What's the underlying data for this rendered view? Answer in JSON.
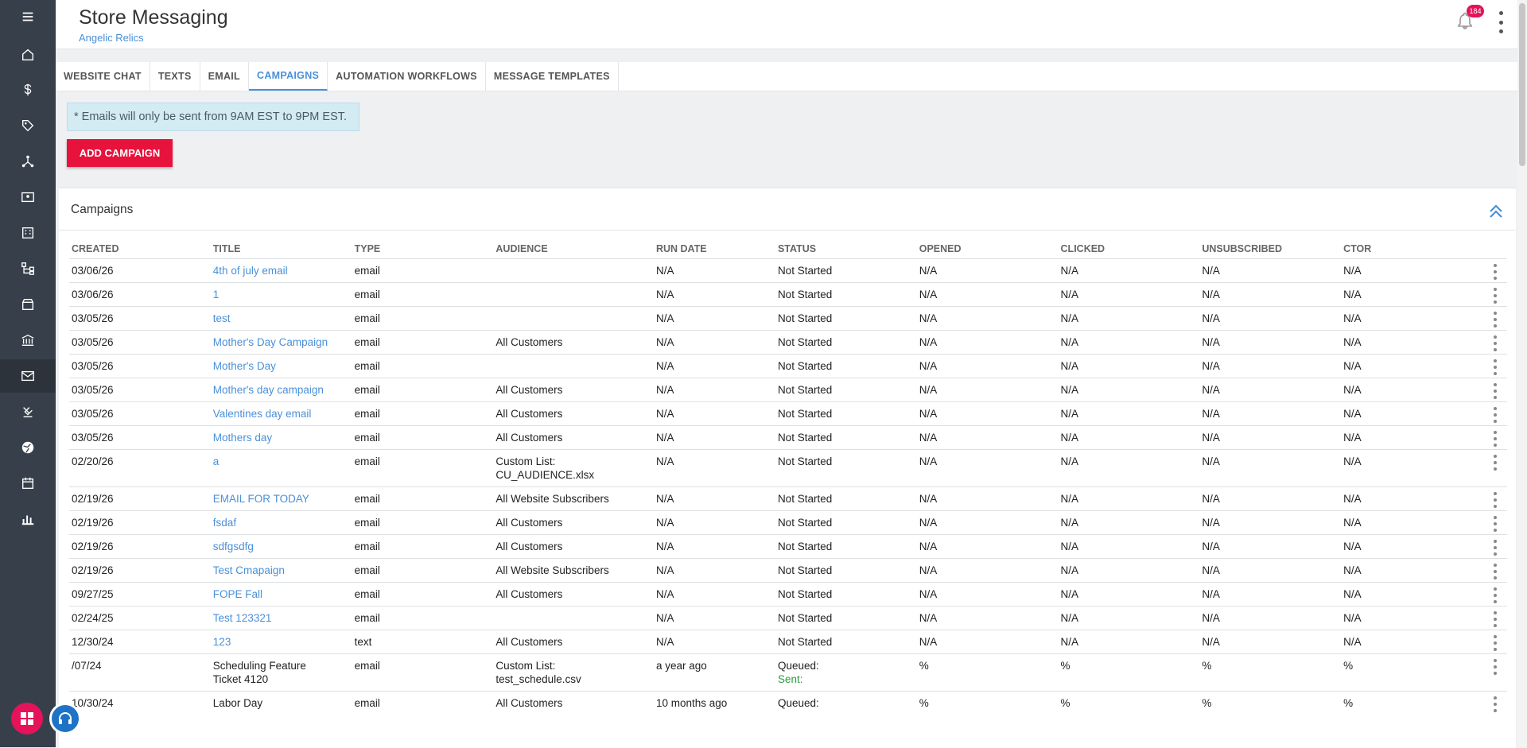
{
  "header": {
    "title": "Store Messaging",
    "subtitle": "Angelic Relics",
    "notification_count": "184"
  },
  "sidebar": {
    "items": [
      "menu-icon",
      "home-icon",
      "dollar-icon",
      "tag-icon",
      "network-icon",
      "id-card-icon",
      "building-icon",
      "sitemap-icon",
      "store-icon",
      "bank-icon",
      "mail-icon",
      "pin-icon",
      "globe-icon",
      "calendar-icon",
      "bar-chart-icon"
    ],
    "active": "mail-icon"
  },
  "tabs": [
    {
      "label": "WEBSITE CHAT"
    },
    {
      "label": "TEXTS"
    },
    {
      "label": "EMAIL"
    },
    {
      "label": "CAMPAIGNS",
      "active": true
    },
    {
      "label": "AUTOMATION WORKFLOWS"
    },
    {
      "label": "MESSAGE TEMPLATES"
    }
  ],
  "notice": "* Emails will only be sent from 9AM EST to 9PM EST.",
  "add_button": "ADD CAMPAIGN",
  "panel": {
    "title": "Campaigns",
    "columns": [
      "CREATED",
      "TITLE",
      "TYPE",
      "AUDIENCE",
      "RUN DATE",
      "STATUS",
      "OPENED",
      "CLICKED",
      "UNSUBSCRIBED",
      "CTOR"
    ],
    "rows": [
      {
        "created": "03/06/26",
        "title": "4th of july email",
        "type": "email",
        "audience": "",
        "run_date": "N/A",
        "status": "Not Started",
        "opened": "N/A",
        "clicked": "N/A",
        "unsubscribed": "N/A",
        "ctor": "N/A"
      },
      {
        "created": "03/06/26",
        "title": "1",
        "type": "email",
        "audience": "",
        "run_date": "N/A",
        "status": "Not Started",
        "opened": "N/A",
        "clicked": "N/A",
        "unsubscribed": "N/A",
        "ctor": "N/A"
      },
      {
        "created": "03/05/26",
        "title": "test",
        "type": "email",
        "audience": "",
        "run_date": "N/A",
        "status": "Not Started",
        "opened": "N/A",
        "clicked": "N/A",
        "unsubscribed": "N/A",
        "ctor": "N/A"
      },
      {
        "created": "03/05/26",
        "title": "Mother's Day Campaign",
        "type": "email",
        "audience": "All Customers",
        "run_date": "N/A",
        "status": "Not Started",
        "opened": "N/A",
        "clicked": "N/A",
        "unsubscribed": "N/A",
        "ctor": "N/A"
      },
      {
        "created": "03/05/26",
        "title": "Mother's Day",
        "type": "email",
        "audience": "",
        "run_date": "N/A",
        "status": "Not Started",
        "opened": "N/A",
        "clicked": "N/A",
        "unsubscribed": "N/A",
        "ctor": "N/A"
      },
      {
        "created": "03/05/26",
        "title": "Mother's day campaign",
        "type": "email",
        "audience": "All Customers",
        "run_date": "N/A",
        "status": "Not Started",
        "opened": "N/A",
        "clicked": "N/A",
        "unsubscribed": "N/A",
        "ctor": "N/A"
      },
      {
        "created": "03/05/26",
        "title": "Valentines day email",
        "type": "email",
        "audience": "All Customers",
        "run_date": "N/A",
        "status": "Not Started",
        "opened": "N/A",
        "clicked": "N/A",
        "unsubscribed": "N/A",
        "ctor": "N/A"
      },
      {
        "created": "03/05/26",
        "title": "Mothers day",
        "type": "email",
        "audience": "All Customers",
        "run_date": "N/A",
        "status": "Not Started",
        "opened": "N/A",
        "clicked": "N/A",
        "unsubscribed": "N/A",
        "ctor": "N/A"
      },
      {
        "created": "02/20/26",
        "title": "a",
        "type": "email",
        "audience": "Custom List:\nCU_AUDIENCE.xlsx",
        "run_date": "N/A",
        "status": "Not Started",
        "opened": "N/A",
        "clicked": "N/A",
        "unsubscribed": "N/A",
        "ctor": "N/A"
      },
      {
        "created": "02/19/26",
        "title": "EMAIL FOR TODAY",
        "type": "email",
        "audience": "All Website Subscribers",
        "run_date": "N/A",
        "status": "Not Started",
        "opened": "N/A",
        "clicked": "N/A",
        "unsubscribed": "N/A",
        "ctor": "N/A"
      },
      {
        "created": "02/19/26",
        "title": "fsdaf",
        "type": "email",
        "audience": "All Customers",
        "run_date": "N/A",
        "status": "Not Started",
        "opened": "N/A",
        "clicked": "N/A",
        "unsubscribed": "N/A",
        "ctor": "N/A"
      },
      {
        "created": "02/19/26",
        "title": "sdfgsdfg",
        "type": "email",
        "audience": "All Customers",
        "run_date": "N/A",
        "status": "Not Started",
        "opened": "N/A",
        "clicked": "N/A",
        "unsubscribed": "N/A",
        "ctor": "N/A"
      },
      {
        "created": "02/19/26",
        "title": "Test Cmapaign",
        "type": "email",
        "audience": "All Website Subscribers",
        "run_date": "N/A",
        "status": "Not Started",
        "opened": "N/A",
        "clicked": "N/A",
        "unsubscribed": "N/A",
        "ctor": "N/A"
      },
      {
        "created": "09/27/25",
        "title": "FOPE Fall",
        "type": "email",
        "audience": "All Customers",
        "run_date": "N/A",
        "status": "Not Started",
        "opened": "N/A",
        "clicked": "N/A",
        "unsubscribed": "N/A",
        "ctor": "N/A"
      },
      {
        "created": "02/24/25",
        "title": "Test 123321",
        "type": "email",
        "audience": "",
        "run_date": "N/A",
        "status": "Not Started",
        "opened": "N/A",
        "clicked": "N/A",
        "unsubscribed": "N/A",
        "ctor": "N/A"
      },
      {
        "created": "12/30/24",
        "title": "123",
        "type": "text",
        "audience": "All Customers",
        "run_date": "N/A",
        "status": "Not Started",
        "opened": "N/A",
        "clicked": "N/A",
        "unsubscribed": "N/A",
        "ctor": "N/A"
      },
      {
        "created": "/07/24",
        "title": "Scheduling Feature\nTicket 4120",
        "title_plain": true,
        "type": "email",
        "audience": "Custom List:\ntest_schedule.csv",
        "run_date": "a year ago",
        "status": "Queued:",
        "status_sent": "Sent:",
        "opened": "%",
        "clicked": "%",
        "unsubscribed": "%",
        "ctor": "%"
      },
      {
        "created": "10/30/24",
        "title": "Labor Day",
        "title_plain": true,
        "type": "email",
        "audience": "All Customers",
        "run_date": "10 months ago",
        "status": "Queued:",
        "opened": "%",
        "clicked": "%",
        "unsubscribed": "%",
        "ctor": "%"
      }
    ]
  }
}
